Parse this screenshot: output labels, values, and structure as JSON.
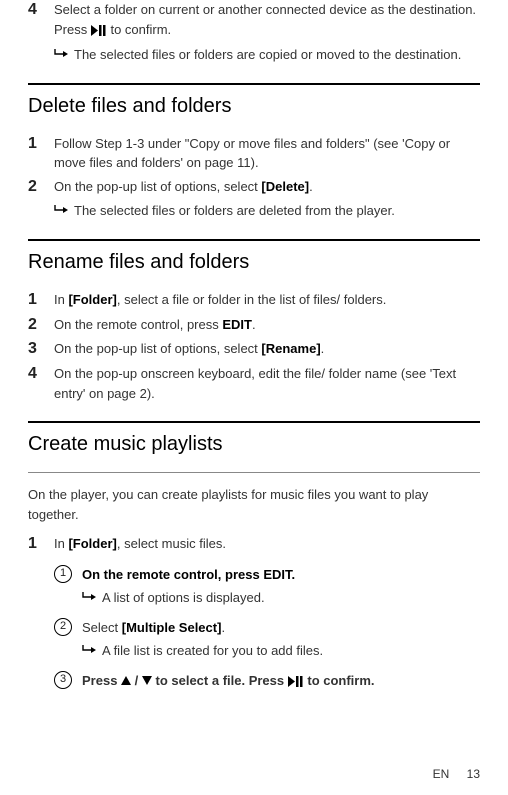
{
  "top_step4": {
    "num": "4",
    "text_before": "Select a folder on current or another connected device as the destination. Press ",
    "text_after": " to confirm.",
    "result": "The selected files or folders are copied or moved to the destination."
  },
  "delete_section": {
    "heading": "Delete files and folders",
    "step1": {
      "num": "1",
      "text": "Follow Step 1-3 under \"Copy or move files and folders\" (see 'Copy or move files and folders' on page 11)."
    },
    "step2": {
      "num": "2",
      "text_before": "On the pop-up list of options, select ",
      "bold": "[Delete]",
      "text_after": ".",
      "result": "The selected files or folders are deleted from the player."
    }
  },
  "rename_section": {
    "heading": "Rename files and folders",
    "step1": {
      "num": "1",
      "text_before": "In ",
      "bold": "[Folder]",
      "text_after": ", select a file or folder in the list of files/ folders."
    },
    "step2": {
      "num": "2",
      "text_before": "On the remote control, press ",
      "bold": "EDIT",
      "text_after": "."
    },
    "step3": {
      "num": "3",
      "text_before": "On the pop-up list of options, select ",
      "bold": "[Rename]",
      "text_after": "."
    },
    "step4": {
      "num": "4",
      "text": "On the pop-up onscreen keyboard, edit the file/ folder name (see 'Text entry' on page 2)."
    }
  },
  "playlist_section": {
    "heading": "Create music playlists",
    "intro": "On the player, you can create playlists for music files you want to play together.",
    "step1": {
      "num": "1",
      "text_before": "In ",
      "bold": "[Folder]",
      "text_after": ", select music files."
    },
    "sub1": {
      "num": "1",
      "bold": "On the remote control, press EDIT.",
      "result": "A list of options is displayed."
    },
    "sub2": {
      "num": "2",
      "text_before": "Select ",
      "bold": "[Multiple Select]",
      "text_after": ".",
      "result": "A file list is created for you to add files."
    },
    "sub3": {
      "num": "3",
      "bold1": "Press ",
      "bold2": " / ",
      "bold3": " to select a file. Press ",
      "bold4": " to confirm."
    }
  },
  "footer": {
    "lang": "EN",
    "page": "13"
  },
  "icons": {
    "play_pause": "play-pause-icon",
    "result_arrow": "↪",
    "up": "▲",
    "down": "▼"
  }
}
